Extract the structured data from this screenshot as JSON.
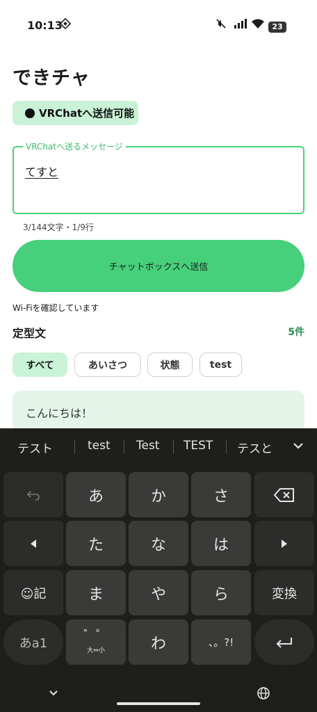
{
  "status_bar": {
    "time": "10:13",
    "battery": "23"
  },
  "app": {
    "title": "できチャ"
  },
  "status_chip": {
    "label": "VRChatへ送信可能"
  },
  "message": {
    "label": "VRChatへ送るメッセージ",
    "value": "てすと",
    "counter": "3/144文字・1/9行"
  },
  "send_button": {
    "label": "チャットボックスへ送信"
  },
  "wifi_status": "Wi-Fiを確認しています",
  "templates": {
    "title": "定型文",
    "count": "5件",
    "filters": [
      "すべて",
      "あいさつ",
      "状態",
      "test"
    ],
    "first_item": "こんにちは！"
  },
  "keyboard": {
    "suggestions": [
      "テスト",
      "test",
      "Test",
      "TEST",
      "テスと"
    ],
    "rows": [
      [
        "↶",
        "あ",
        "か",
        "さ",
        "⌫"
      ],
      [
        "◀",
        "た",
        "な",
        "は",
        "▶"
      ],
      [
        "☺記",
        "ま",
        "や",
        "ら",
        "変換"
      ],
      [
        "あa1",
        "゛゜",
        "わ",
        "、。?!",
        "↵"
      ]
    ],
    "dakuten_sub": "大⇔小"
  },
  "colors": {
    "accent": "#47d07b",
    "chip_bg": "#c9f2d6",
    "card_bg": "#e3f4e8",
    "keyboard_bg": "#1e1f1b"
  }
}
